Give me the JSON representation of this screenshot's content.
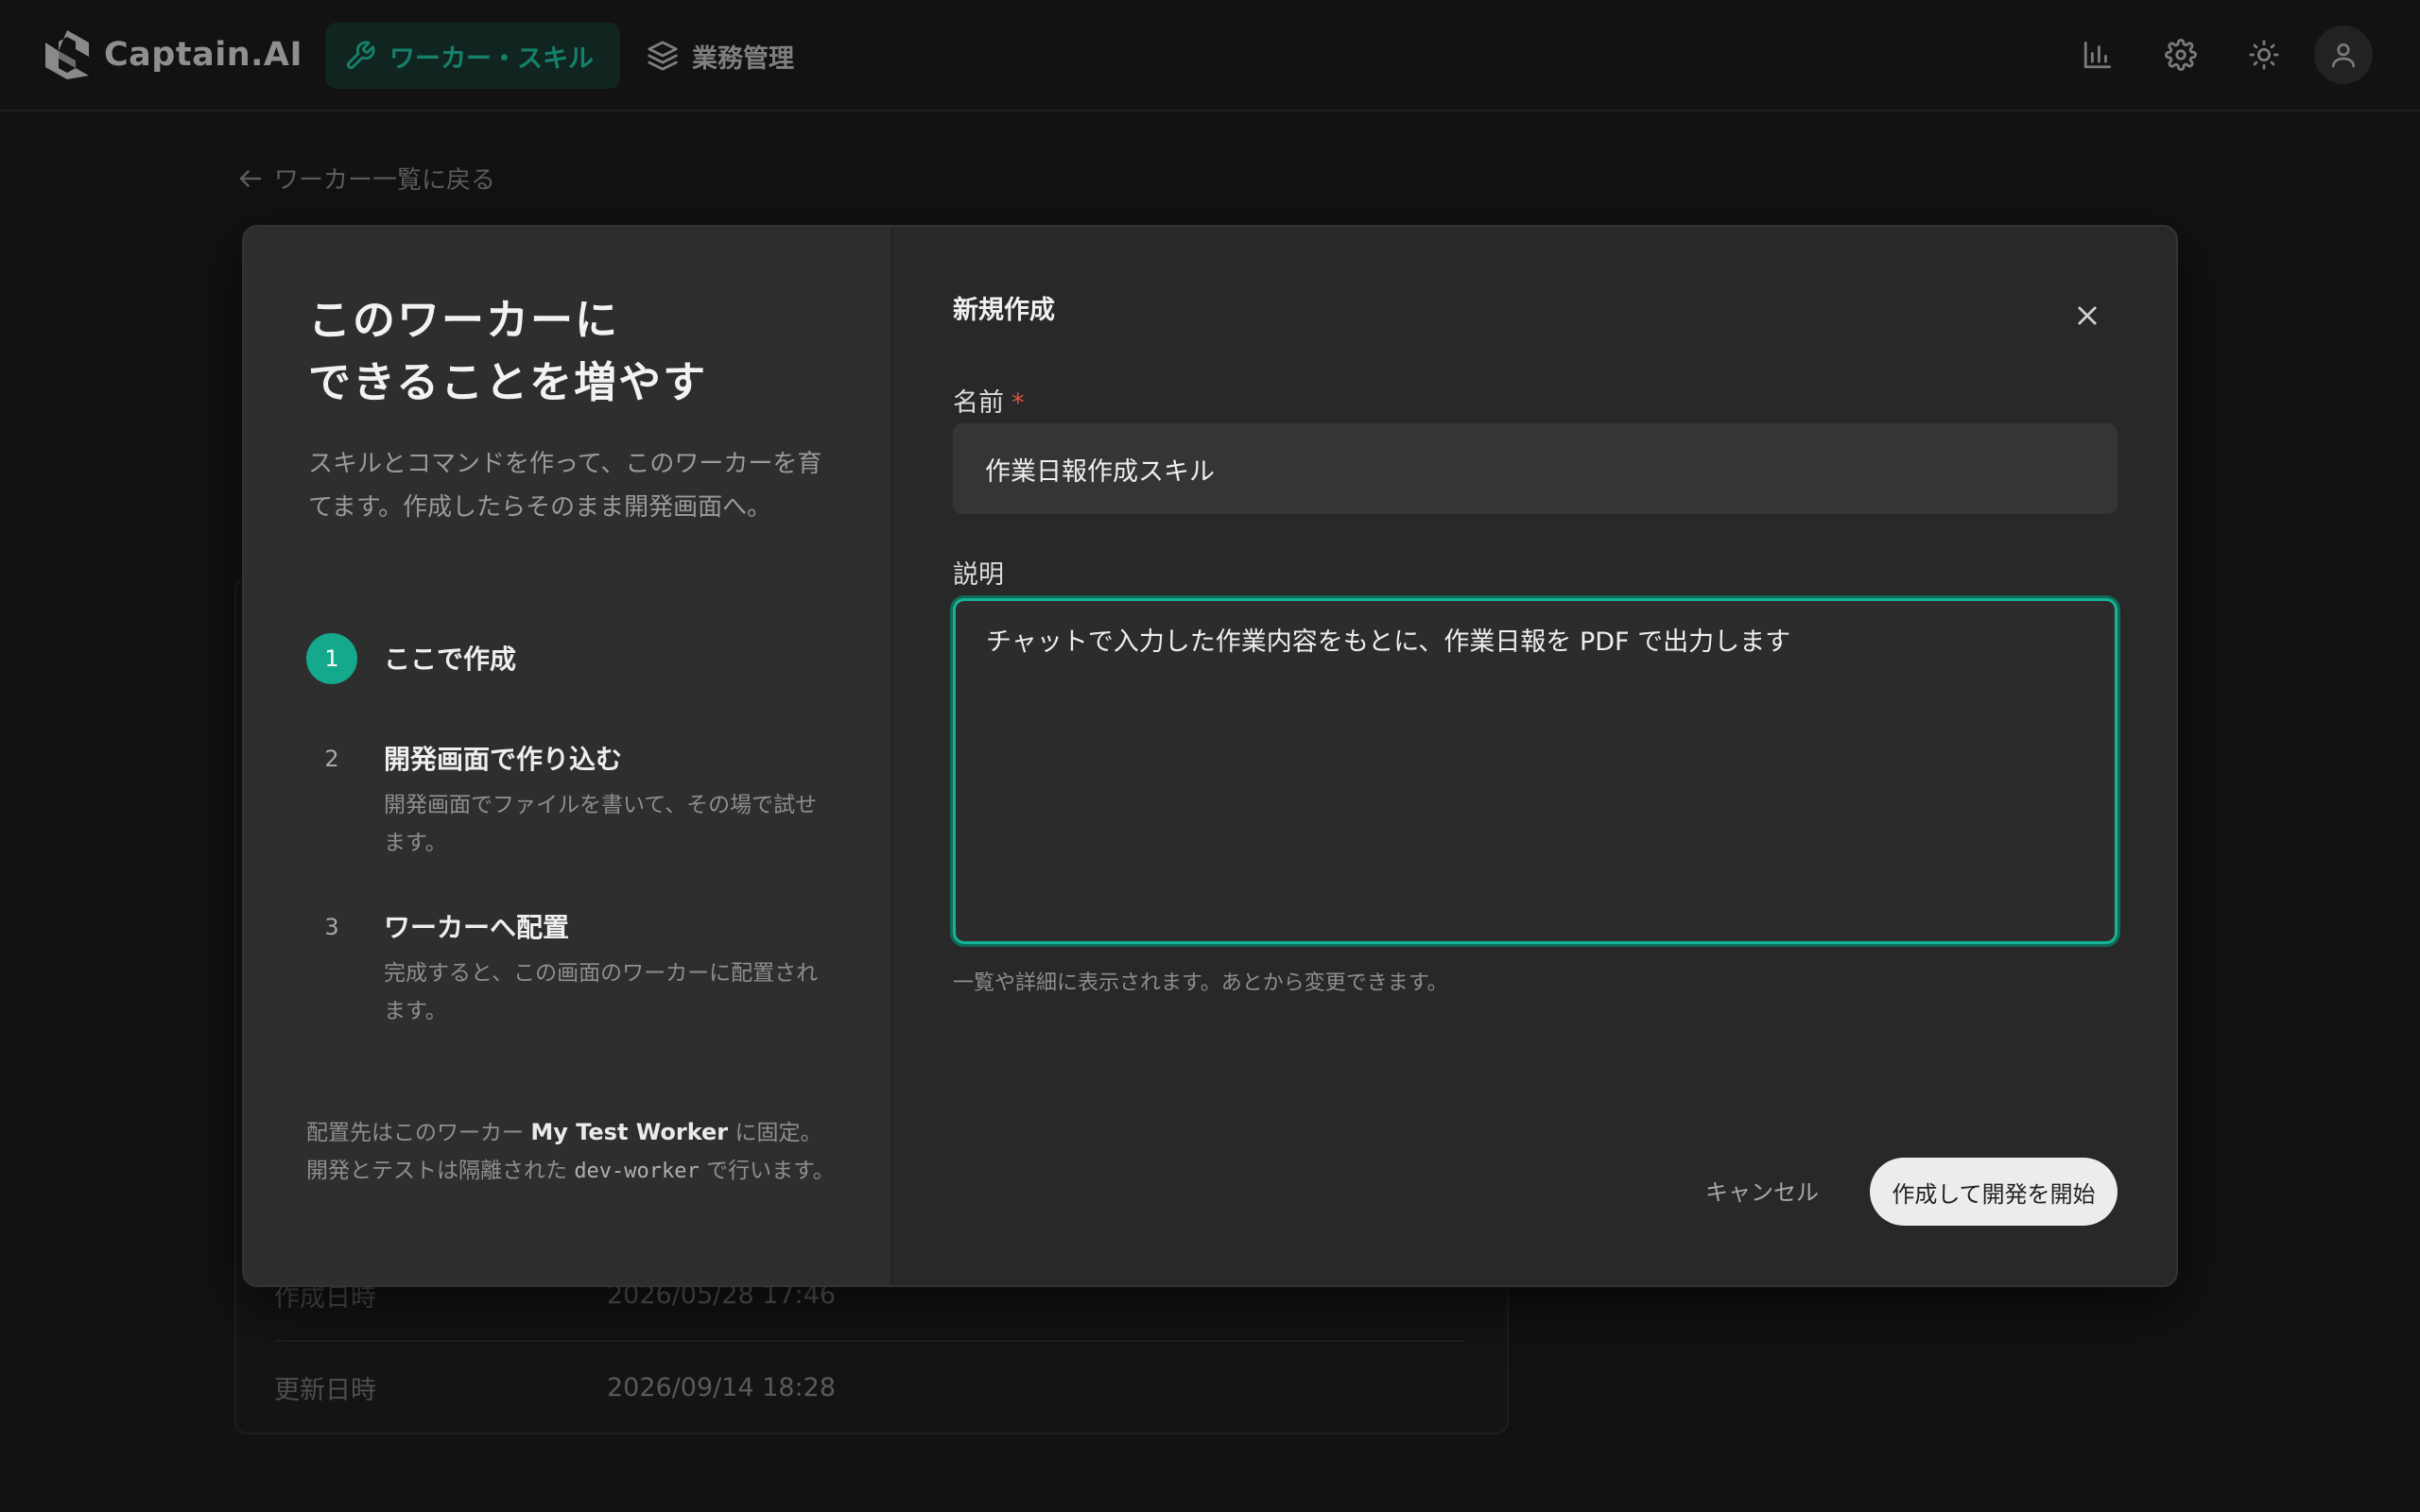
{
  "app": {
    "brand": "Captain.AI"
  },
  "nav": {
    "tabs": [
      {
        "label": "ワーカー・スキル",
        "icon": "wrench-icon",
        "active": true
      },
      {
        "label": "業務管理",
        "icon": "layers-icon",
        "active": false
      }
    ],
    "actions": [
      "bar-chart-icon",
      "gear-icon",
      "sun-icon",
      "user-icon"
    ]
  },
  "background": {
    "back_link": "ワーカー一覧に戻る",
    "rows": [
      {
        "label": "作成日時",
        "value": "2026/05/28 17:46"
      },
      {
        "label": "更新日時",
        "value": "2026/09/14 18:28"
      }
    ]
  },
  "modal": {
    "heading_line1": "このワーカーに",
    "heading_line2": "できることを増やす",
    "intro": "スキルとコマンドを作って、このワーカーを育てます。作成したらそのまま開発画面へ。",
    "steps": [
      {
        "num": "1",
        "title": "ここで作成",
        "desc": ""
      },
      {
        "num": "2",
        "title": "開発画面で作り込む",
        "desc": "開発画面でファイルを書いて、その場で試せます。"
      },
      {
        "num": "3",
        "title": "ワーカーへ配置",
        "desc": "完成すると、この画面のワーカーに配置されます。"
      }
    ],
    "footnote": {
      "part1": "配置先はこのワーカー ",
      "worker_name": "My Test Worker",
      "part2": " に固定。開発とテストは隔離された ",
      "code": "dev-worker",
      "part3": " で行います。"
    },
    "form_title": "新規作成",
    "name_label": "名前",
    "required_mark": "*",
    "name_value": "作業日報作成スキル",
    "desc_label": "説明",
    "desc_value": "チャットで入力した作業内容をもとに、作業日報を PDF で出力します",
    "hint": "一覧や詳細に表示されます。あとから変更できます。",
    "cancel_label": "キャンセル",
    "submit_label": "作成して開発を開始"
  },
  "colors": {
    "accent": "#14a88c",
    "accent_dark": "#15806b",
    "required": "#e0523f"
  }
}
